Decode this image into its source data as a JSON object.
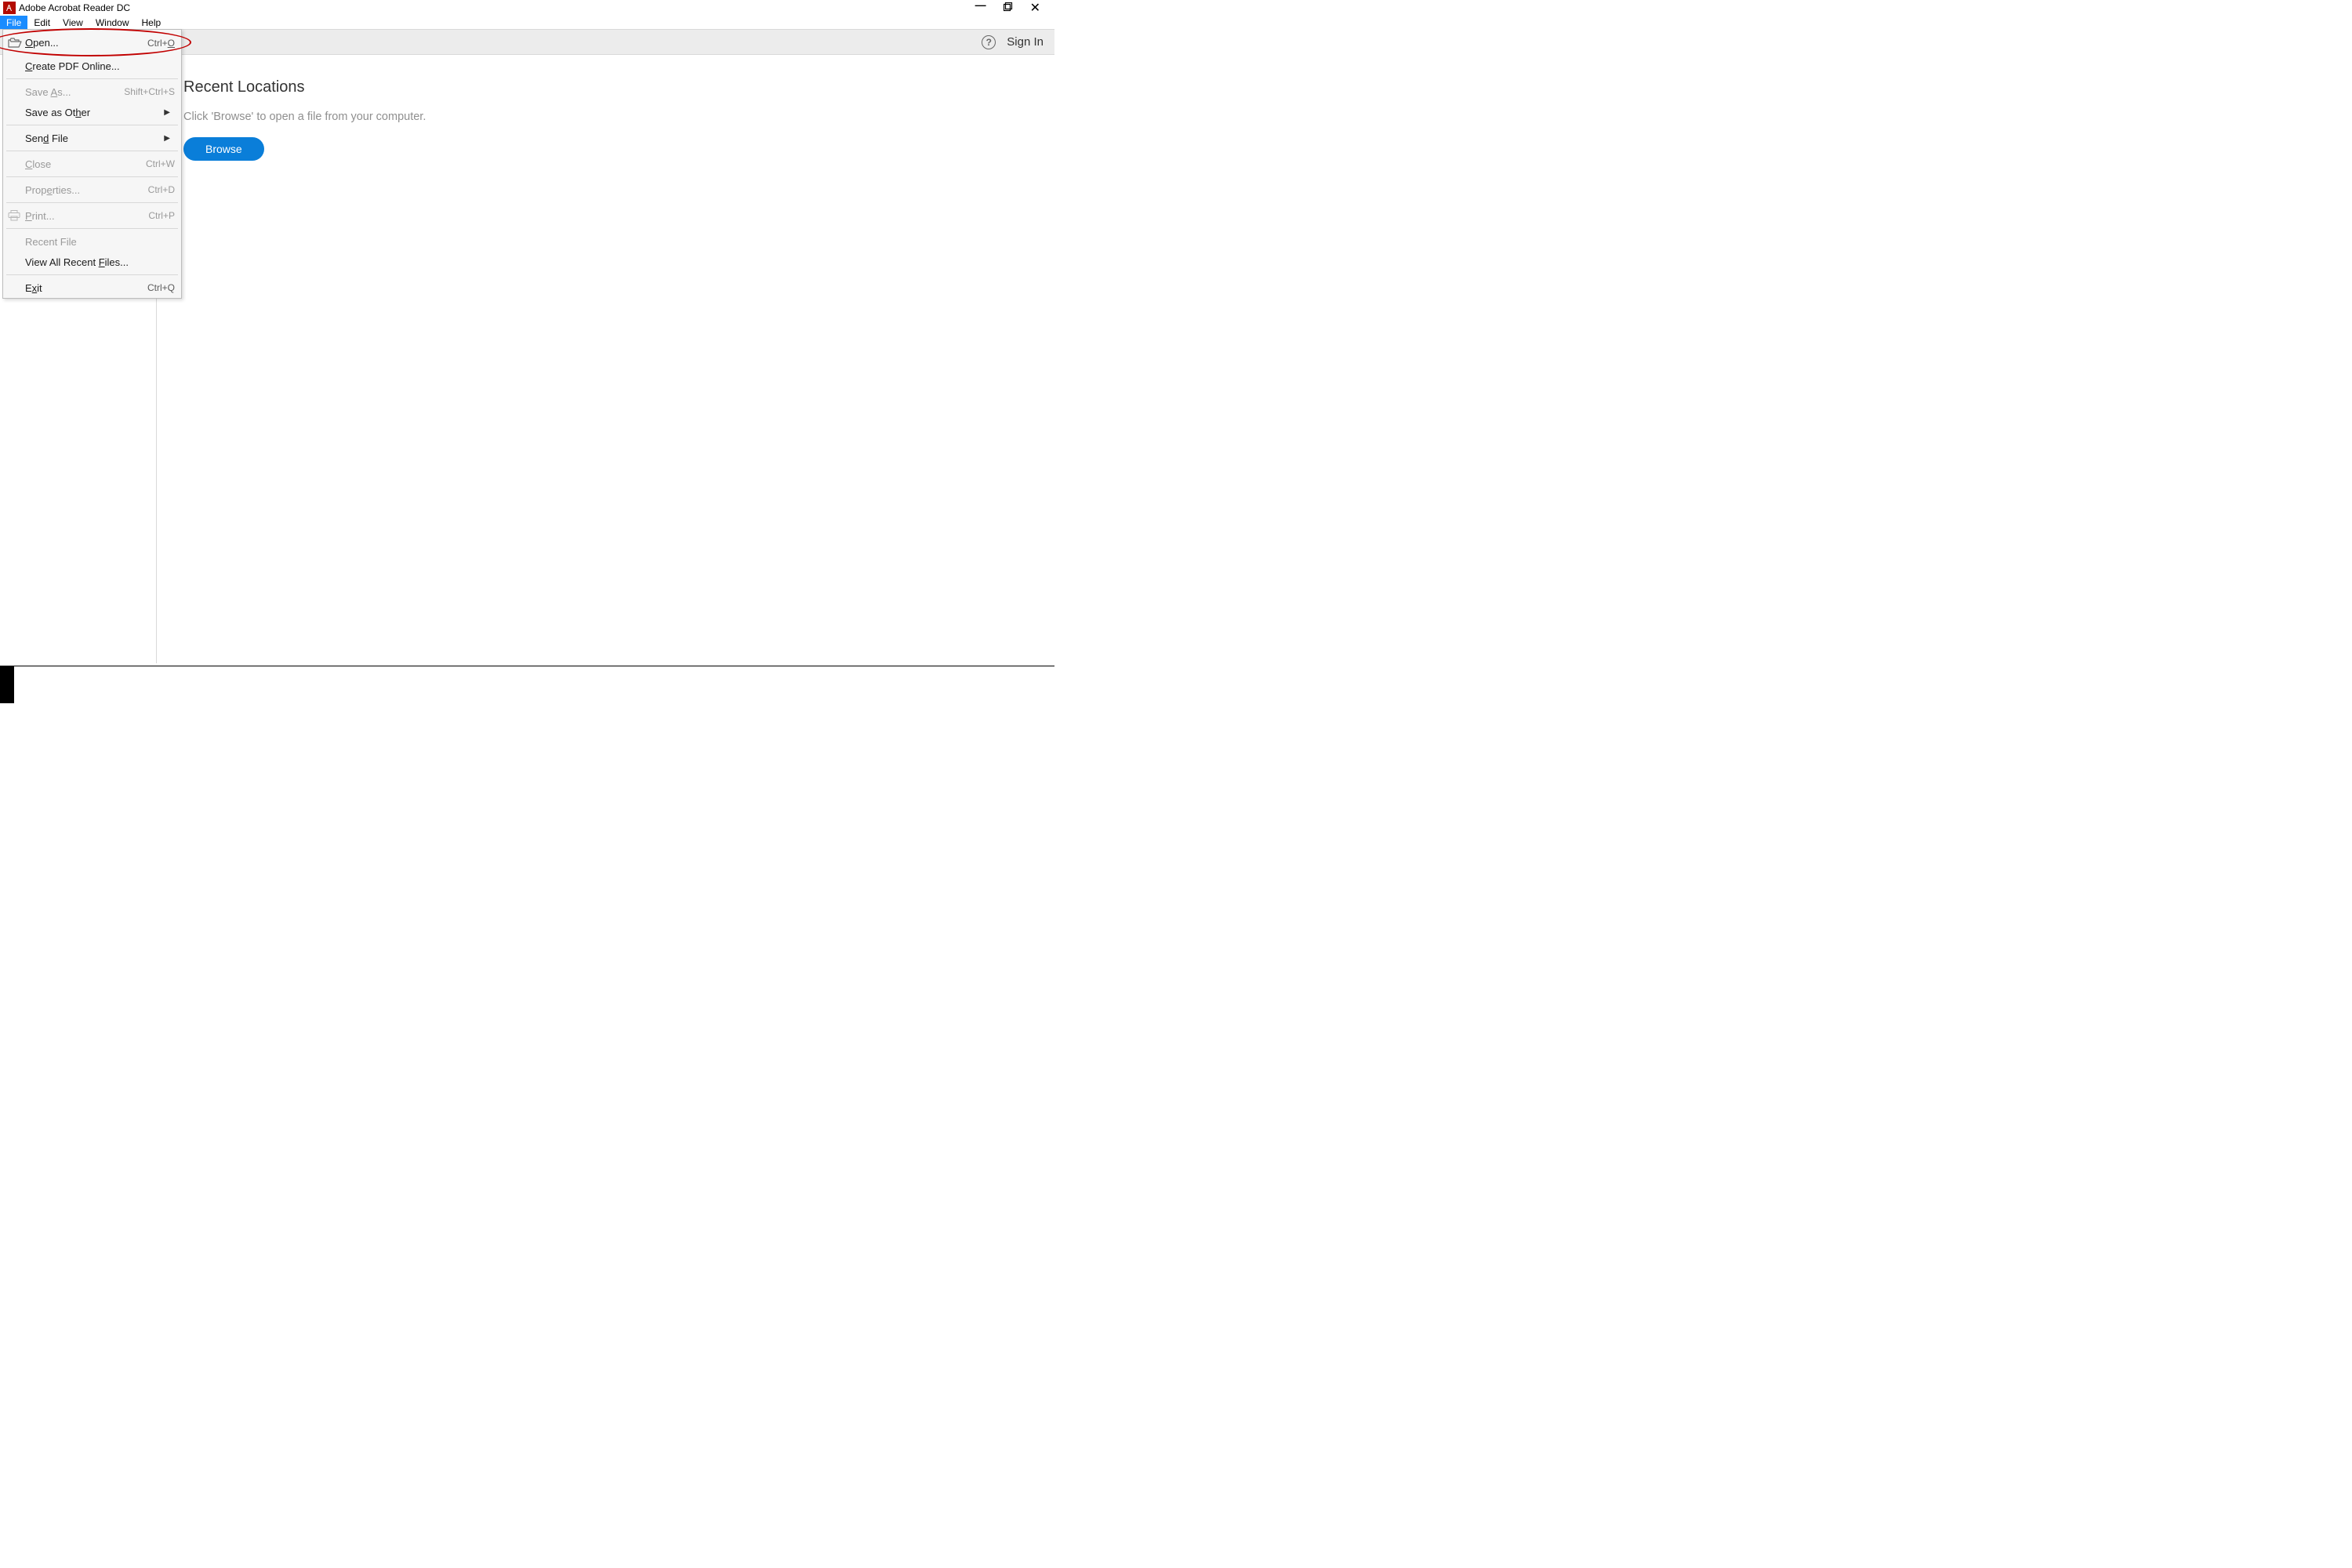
{
  "app": {
    "title": "Adobe Acrobat Reader DC"
  },
  "menubar": {
    "items": [
      "File",
      "Edit",
      "View",
      "Window",
      "Help"
    ],
    "active": "File"
  },
  "toolbar": {
    "signin": "Sign In"
  },
  "dropdown": {
    "open": {
      "label": "Open...",
      "shortcut": "Ctrl+O"
    },
    "create_pdf": {
      "label": "Create PDF Online..."
    },
    "save_as": {
      "label": "Save As...",
      "shortcut": "Shift+Ctrl+S"
    },
    "save_other": {
      "label": "Save as Other"
    },
    "send_file": {
      "label": "Send File"
    },
    "close": {
      "label": "Close",
      "shortcut": "Ctrl+W"
    },
    "properties": {
      "label": "Properties...",
      "shortcut": "Ctrl+D"
    },
    "print": {
      "label": "Print...",
      "shortcut": "Ctrl+P"
    },
    "recent_file": {
      "label": "Recent File"
    },
    "view_recent": {
      "label": "View All Recent Files..."
    },
    "exit": {
      "label": "Exit",
      "shortcut": "Ctrl+Q"
    }
  },
  "main": {
    "recent_title": "Recent Locations",
    "recent_hint": "Click 'Browse' to open a file from your computer.",
    "browse": "Browse"
  }
}
